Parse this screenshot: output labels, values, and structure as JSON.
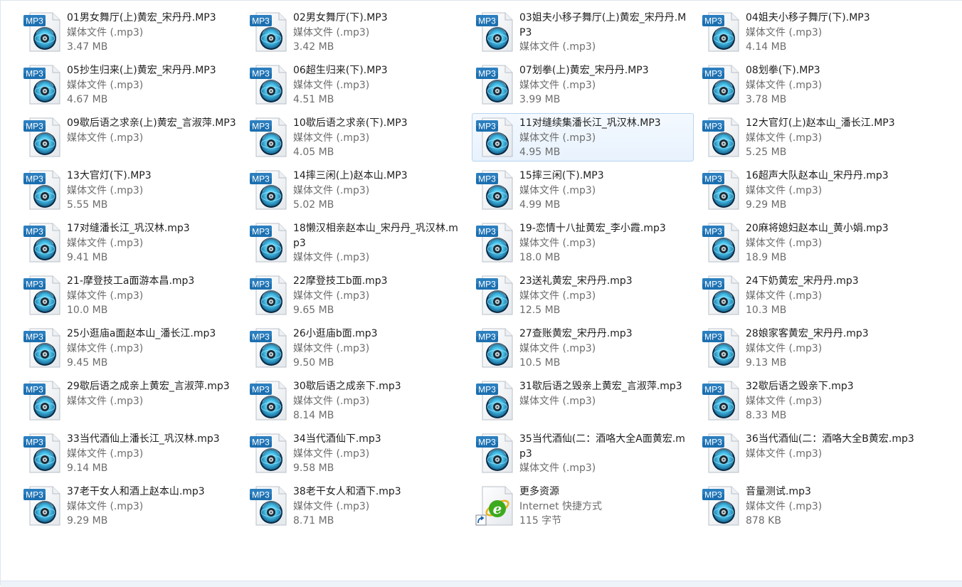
{
  "colors": {
    "mp3_badge": "#1b6fb0",
    "selection_fill": "#e8f2fd",
    "selection_border": "#b9d4f1",
    "ie_green": "#3daa1e"
  },
  "files": [
    {
      "name": "01男女舞厅(上)黄宏_宋丹丹.MP3",
      "type": "媒体文件 (.mp3)",
      "size": "3.47 MB",
      "icon": "mp3-file-icon"
    },
    {
      "name": "02男女舞厅(下).MP3",
      "type": "媒体文件 (.mp3)",
      "size": "3.42 MB",
      "icon": "mp3-file-icon"
    },
    {
      "name": "03姐夫小移子舞厅(上)黄宏_宋丹丹.MP3",
      "type": "媒体文件 (.mp3)",
      "size": "",
      "icon": "mp3-file-icon"
    },
    {
      "name": "04姐夫小移子舞厅(下).MP3",
      "type": "媒体文件 (.mp3)",
      "size": "4.14 MB",
      "icon": "mp3-file-icon"
    },
    {
      "name": "05抄生归来(上)黄宏_宋丹丹.MP3",
      "type": "媒体文件 (.mp3)",
      "size": "4.67 MB",
      "icon": "mp3-file-icon"
    },
    {
      "name": "06超生归来(下).MP3",
      "type": "媒体文件 (.mp3)",
      "size": "4.51 MB",
      "icon": "mp3-file-icon"
    },
    {
      "name": "07划拳(上)黄宏_宋丹丹.MP3",
      "type": "媒体文件 (.mp3)",
      "size": "3.99 MB",
      "icon": "mp3-file-icon"
    },
    {
      "name": "08划拳(下).MP3",
      "type": "媒体文件 (.mp3)",
      "size": "3.78 MB",
      "icon": "mp3-file-icon"
    },
    {
      "name": "09歇后语之求亲(上)黄宏_言淑萍.MP3",
      "type": "媒体文件 (.mp3)",
      "size": "",
      "icon": "mp3-file-icon"
    },
    {
      "name": "10歇后语之求亲(下).MP3",
      "type": "媒体文件 (.mp3)",
      "size": "4.05 MB",
      "icon": "mp3-file-icon"
    },
    {
      "name": "11对缝续集潘长江_巩汉林.MP3",
      "type": "媒体文件 (.mp3)",
      "size": "4.95 MB",
      "icon": "mp3-file-icon",
      "selected": true
    },
    {
      "name": "12大官灯(上)赵本山_潘长江.MP3",
      "type": "媒体文件 (.mp3)",
      "size": "5.25 MB",
      "icon": "mp3-file-icon"
    },
    {
      "name": "13大官灯(下).MP3",
      "type": "媒体文件 (.mp3)",
      "size": "5.55 MB",
      "icon": "mp3-file-icon"
    },
    {
      "name": "14摔三闲(上)赵本山.MP3",
      "type": "媒体文件 (.mp3)",
      "size": "5.02 MB",
      "icon": "mp3-file-icon"
    },
    {
      "name": "15摔三闲(下).MP3",
      "type": "媒体文件 (.mp3)",
      "size": "4.99 MB",
      "icon": "mp3-file-icon"
    },
    {
      "name": "16超声大队赵本山_宋丹丹.mp3",
      "type": "媒体文件 (.mp3)",
      "size": "9.29 MB",
      "icon": "mp3-file-icon"
    },
    {
      "name": "17对缝潘长江_巩汉林.mp3",
      "type": "媒体文件 (.mp3)",
      "size": "9.41 MB",
      "icon": "mp3-file-icon"
    },
    {
      "name": "18懒汉相亲赵本山_宋丹丹_巩汉林.mp3",
      "type": "媒体文件 (.mp3)",
      "size": "",
      "icon": "mp3-file-icon"
    },
    {
      "name": "19-恋情十八扯黄宏_李小霞.mp3",
      "type": "媒体文件 (.mp3)",
      "size": "18.0 MB",
      "icon": "mp3-file-icon"
    },
    {
      "name": "20麻将媳妇赵本山_黄小娟.mp3",
      "type": "媒体文件 (.mp3)",
      "size": "18.9 MB",
      "icon": "mp3-file-icon"
    },
    {
      "name": "21-摩登技工a面游本昌.mp3",
      "type": "媒体文件 (.mp3)",
      "size": "10.0 MB",
      "icon": "mp3-file-icon"
    },
    {
      "name": "22摩登技工b面.mp3",
      "type": "媒体文件 (.mp3)",
      "size": "9.65 MB",
      "icon": "mp3-file-icon"
    },
    {
      "name": "23送礼黄宏_宋丹丹.mp3",
      "type": "媒体文件 (.mp3)",
      "size": "12.5 MB",
      "icon": "mp3-file-icon"
    },
    {
      "name": "24下奶黄宏_宋丹丹.mp3",
      "type": "媒体文件 (.mp3)",
      "size": "10.3 MB",
      "icon": "mp3-file-icon"
    },
    {
      "name": "25小逛庙a面赵本山_潘长江.mp3",
      "type": "媒体文件 (.mp3)",
      "size": "9.45 MB",
      "icon": "mp3-file-icon"
    },
    {
      "name": "26小逛庙b面.mp3",
      "type": "媒体文件 (.mp3)",
      "size": "9.50 MB",
      "icon": "mp3-file-icon"
    },
    {
      "name": "27查账黄宏_宋丹丹.mp3",
      "type": "媒体文件 (.mp3)",
      "size": "10.5 MB",
      "icon": "mp3-file-icon"
    },
    {
      "name": "28娘家客黄宏_宋丹丹.mp3",
      "type": "媒体文件 (.mp3)",
      "size": "9.13 MB",
      "icon": "mp3-file-icon"
    },
    {
      "name": "29歇后语之成亲上黄宏_言淑萍.mp3",
      "type": "媒体文件 (.mp3)",
      "size": "",
      "icon": "mp3-file-icon"
    },
    {
      "name": "30歇后语之成亲下.mp3",
      "type": "媒体文件 (.mp3)",
      "size": "8.14 MB",
      "icon": "mp3-file-icon"
    },
    {
      "name": "31歇后语之毁亲上黄宏_言淑萍.mp3",
      "type": "媒体文件 (.mp3)",
      "size": "",
      "icon": "mp3-file-icon"
    },
    {
      "name": "32歇后语之毁亲下.mp3",
      "type": "媒体文件 (.mp3)",
      "size": "8.33 MB",
      "icon": "mp3-file-icon"
    },
    {
      "name": "33当代酒仙上潘长江_巩汉林.mp3",
      "type": "媒体文件 (.mp3)",
      "size": "9.14 MB",
      "icon": "mp3-file-icon"
    },
    {
      "name": "34当代酒仙下.mp3",
      "type": "媒体文件 (.mp3)",
      "size": "9.58 MB",
      "icon": "mp3-file-icon"
    },
    {
      "name": "35当代酒仙(二：酒咯大全A面黄宏.mp3",
      "type": "媒体文件 (.mp3)",
      "size": "",
      "icon": "mp3-file-icon"
    },
    {
      "name": "36当代酒仙(二：酒咯大全B黄宏.mp3",
      "type": "媒体文件 (.mp3)",
      "size": "",
      "icon": "mp3-file-icon"
    },
    {
      "name": "37老干女人和酒上赵本山.mp3",
      "type": "媒体文件 (.mp3)",
      "size": "9.29 MB",
      "icon": "mp3-file-icon"
    },
    {
      "name": "38老干女人和酒下.mp3",
      "type": "媒体文件 (.mp3)",
      "size": "8.71 MB",
      "icon": "mp3-file-icon"
    },
    {
      "name": "更多资源",
      "type": "Internet 快捷方式",
      "size": "115 字节",
      "icon": "internet-shortcut-icon"
    },
    {
      "name": "音量测试.mp3",
      "type": "媒体文件 (.mp3)",
      "size": "878 KB",
      "icon": "mp3-file-icon"
    }
  ]
}
